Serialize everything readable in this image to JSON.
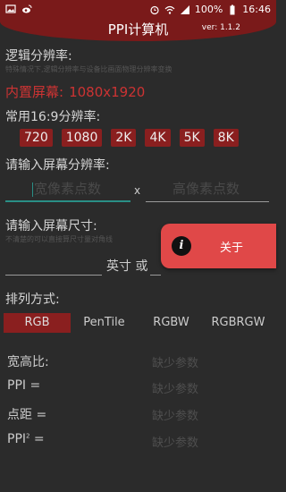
{
  "statusbar": {
    "battery": "100%",
    "time": "16:46"
  },
  "app": {
    "title": "PPI计算机",
    "version": "ver: 1.1.2"
  },
  "logical_res": {
    "label": "逻辑分辨率:",
    "hint": "特殊情况下,逻辑分辨率与设备比画面物理分辨率变换",
    "builtin_label": "内置屏幕:",
    "builtin_value": "1080x1920"
  },
  "common": {
    "label": "常用16:9分辨率:",
    "buttons": [
      "720",
      "1080",
      "2K",
      "4K",
      "5K",
      "8K"
    ]
  },
  "input_res": {
    "label": "请输入屏幕分辨率:",
    "width_placeholder": "宽像素点数",
    "separator": "x",
    "height_placeholder": "高像素点数"
  },
  "input_size": {
    "label": "请输入屏幕尺寸:",
    "hint": "不清楚的可以直接算尺寸量对角线",
    "unit_text": "英寸 或"
  },
  "fab": {
    "label": "关于"
  },
  "arrangement": {
    "label": "排列方式:",
    "tabs": [
      "RGB",
      "PenTile",
      "RGBW",
      "RGBRGW"
    ]
  },
  "results": [
    {
      "label": "宽高比:",
      "value": "缺少参数"
    },
    {
      "label": "PPI =",
      "value": "缺少参数"
    },
    {
      "label": "点距 =",
      "value": "缺少参数"
    },
    {
      "label": "PPI",
      "sup": "2",
      "label_suffix": " =",
      "value": "缺少参数"
    }
  ],
  "colors": {
    "accent": "#8a1f1f",
    "fab": "#e04848",
    "focus": "#2a8f86",
    "builtin": "#cc3333"
  }
}
